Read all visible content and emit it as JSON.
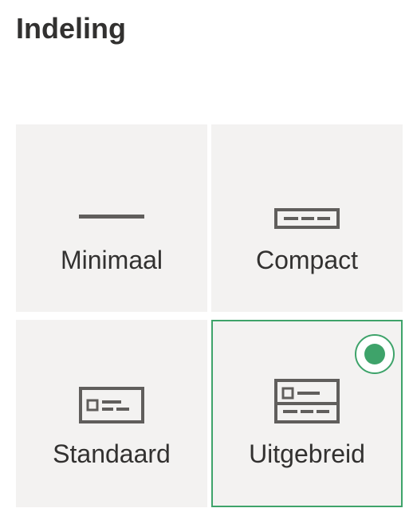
{
  "page": {
    "title": "Indeling"
  },
  "colors": {
    "tile_background": "#f3f2f1",
    "selected_accent": "#3ea36a",
    "text": "#323130",
    "icon": "#605e5c"
  },
  "layouts": [
    {
      "label": "Minimaal",
      "icon": "minimal-layout-icon",
      "selected": false
    },
    {
      "label": "Compact",
      "icon": "compact-layout-icon",
      "selected": false
    },
    {
      "label": "Standaard",
      "icon": "standard-layout-icon",
      "selected": false
    },
    {
      "label": "Uitgebreid",
      "icon": "expanded-layout-icon",
      "selected": true
    }
  ]
}
